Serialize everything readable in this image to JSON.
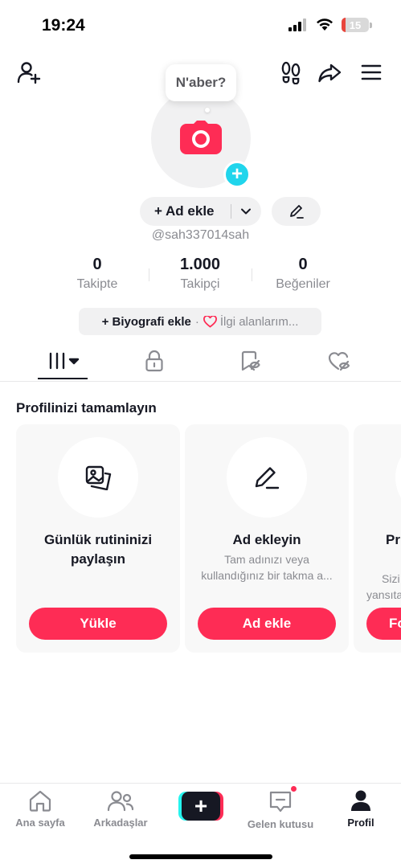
{
  "status_bar": {
    "time": "19:24",
    "battery": "15",
    "battery_fraction": 0.15
  },
  "header": {
    "icons": [
      "add-friend-icon",
      "footprints-icon",
      "share-icon",
      "menu-icon"
    ]
  },
  "profile": {
    "bubble_text": "N'aber?",
    "name_button_label": "+ Ad ekle",
    "username": "@sah337014sah",
    "stats": [
      {
        "value": "0",
        "label": "Takipte"
      },
      {
        "value": "1.000",
        "label": "Takipçi"
      },
      {
        "value": "0",
        "label": "Beğeniler"
      }
    ],
    "bio_add_label": "+ Biyografi ekle",
    "bio_separator": "·",
    "interests_label": "İlgi alanlarım..."
  },
  "tabs": [
    "videos-grid-icon",
    "lock-icon",
    "bookmark-icon",
    "liked-heart-icon"
  ],
  "complete_profile": {
    "title": "Profilinizi tamamlayın",
    "cards": [
      {
        "icon": "photos-icon",
        "title_line1": "Günlük rutininizi",
        "title_line2": "paylaşın",
        "desc_line1": "",
        "desc_line2": "",
        "button": "Yükle"
      },
      {
        "icon": "pencil-icon",
        "title_line1": "Ad ekleyin",
        "title_line2": "",
        "desc_line1": "Tam adınızı veya",
        "desc_line2": "kullandığınız bir takma a...",
        "button": "Ad ekle"
      },
      {
        "icon": "",
        "title_line1": "Pr",
        "title_line2": "",
        "desc_line1": "Sizi",
        "desc_line2": "yansıta",
        "button": "Fo"
      }
    ]
  },
  "bottom_nav": [
    {
      "label": "Ana sayfa",
      "icon": "home-icon"
    },
    {
      "label": "Arkadaşlar",
      "icon": "friends-icon"
    },
    {
      "label": "",
      "icon": "create-plus-icon"
    },
    {
      "label": "Gelen kutusu",
      "icon": "inbox-icon"
    },
    {
      "label": "Profil",
      "icon": "profile-icon"
    }
  ],
  "colors": {
    "accent": "#fe2c55",
    "cyan": "#20d5ec",
    "text": "#161823",
    "muted": "#8a8b91"
  }
}
